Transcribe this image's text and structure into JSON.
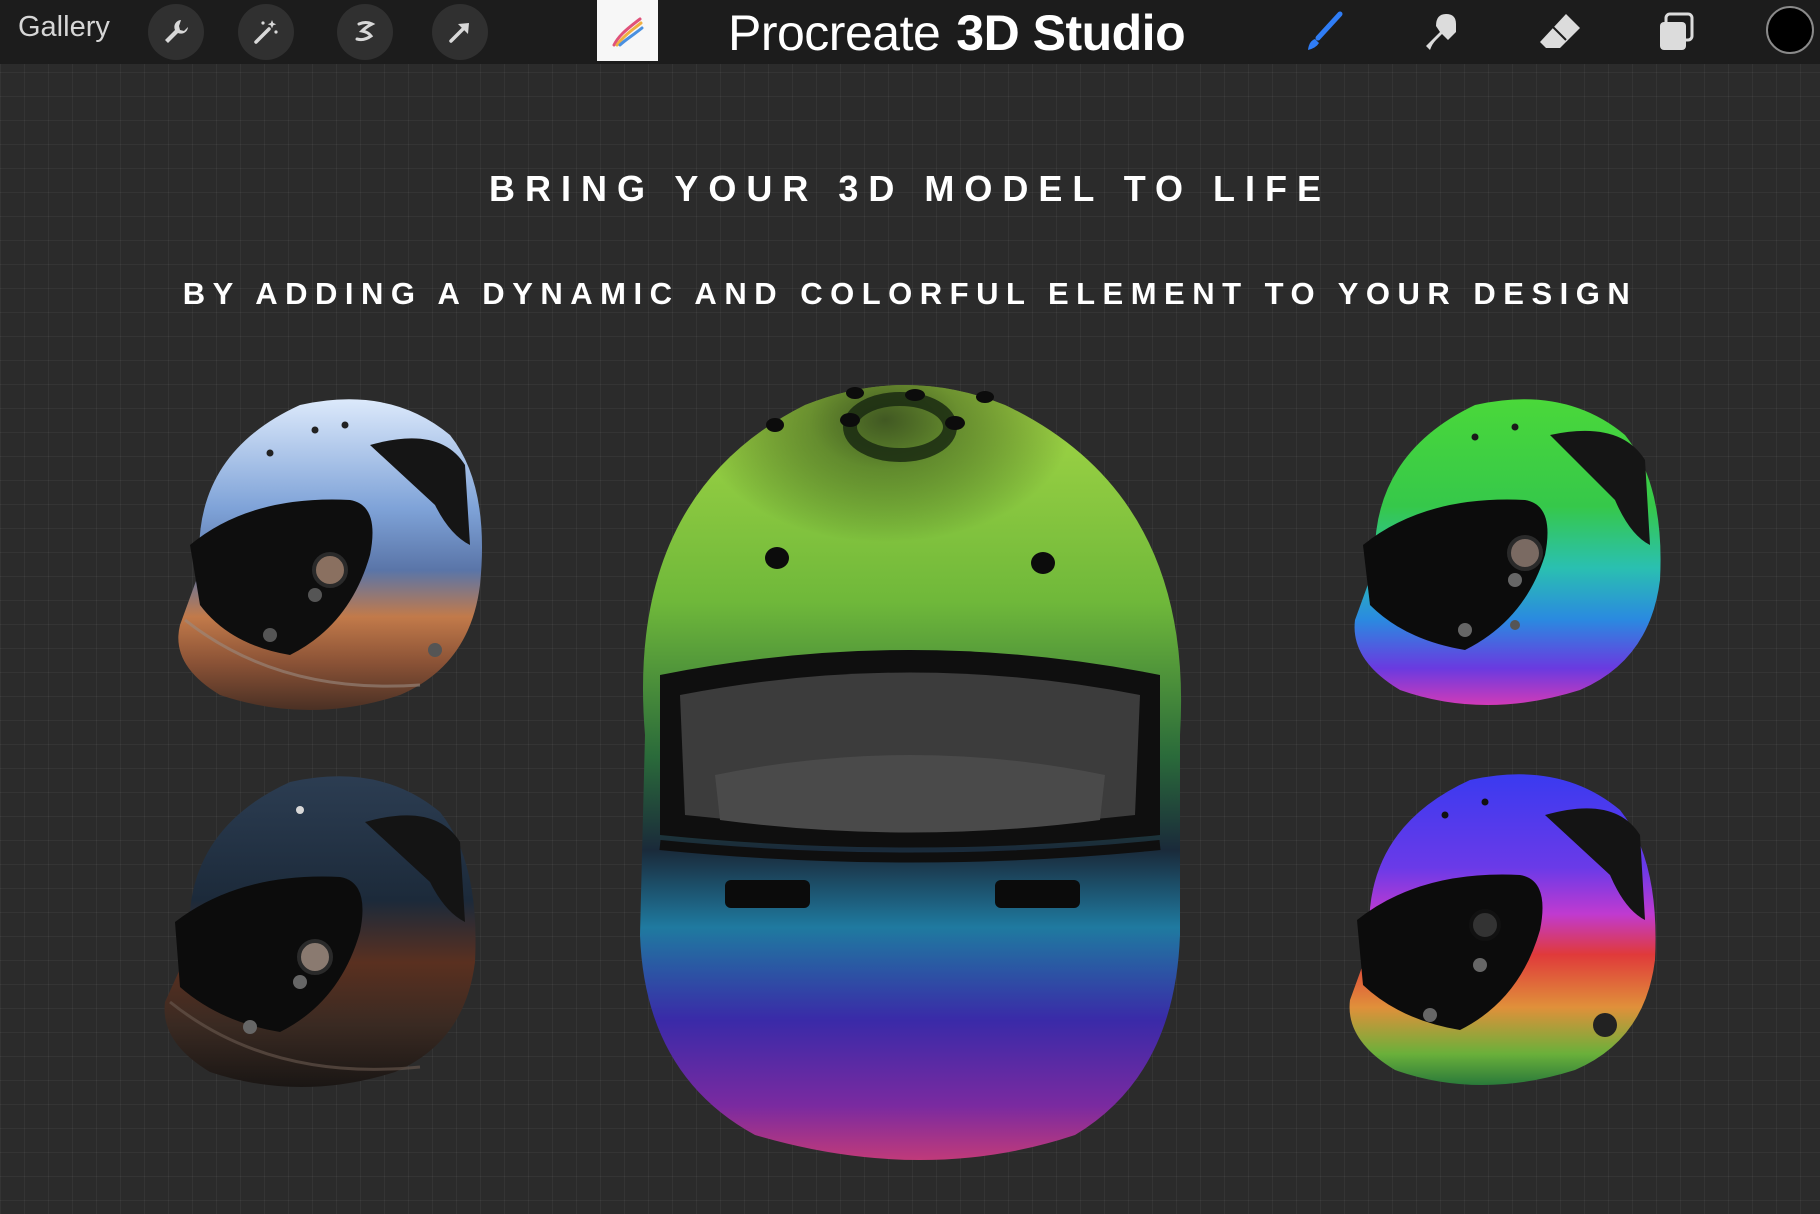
{
  "toolbar": {
    "gallery_label": "Gallery",
    "left_tools": [
      {
        "icon": "wrench-icon",
        "name": "actions"
      },
      {
        "icon": "magic-wand-icon",
        "name": "adjustments"
      },
      {
        "icon": "selection-icon",
        "name": "selection"
      },
      {
        "icon": "arrow-cursor-icon",
        "name": "transform"
      }
    ],
    "title_primary": "Procreate",
    "title_secondary": "3D Studio",
    "right_tools": [
      {
        "icon": "brush-icon",
        "name": "paint",
        "active": true,
        "color": "#2f7df6"
      },
      {
        "icon": "smudge-icon",
        "name": "smudge",
        "active": false,
        "color": "#dcdcdc"
      },
      {
        "icon": "eraser-icon",
        "name": "erase",
        "active": false,
        "color": "#dcdcdc"
      },
      {
        "icon": "layers-icon",
        "name": "layers",
        "active": false,
        "color": "#dcdcdc"
      }
    ],
    "current_color": "#000000"
  },
  "headings": {
    "line1": "BRING YOUR 3D MODEL TO LIFE",
    "line2": "BY ADDING A DYNAMIC AND COLORFUL ELEMENT TO YOUR DESIGN"
  },
  "colors": {
    "background": "#2b2b2b",
    "toolbar": "#1c1c1c",
    "accent": "#2f7df6"
  },
  "helmets": [
    {
      "id": "helmet-chrome-landscape",
      "finish": "chrome",
      "colors": [
        "#bcd4f2",
        "#6b8fc5",
        "#c86a3a",
        "#8a4a2a"
      ]
    },
    {
      "id": "helmet-dark-landscape",
      "finish": "dark chrome",
      "colors": [
        "#1c2a3a",
        "#243448",
        "#6a3520",
        "#3a2a20"
      ]
    },
    {
      "id": "helmet-tie-dye-main",
      "finish": "tie-dye",
      "colors": [
        "#9ad43a",
        "#5aa02a",
        "#26b0b8",
        "#4a2ad0",
        "#b02aa0"
      ]
    },
    {
      "id": "helmet-rainbow-gradient",
      "finish": "gradient",
      "colors": [
        "#3fd43a",
        "#28c8a0",
        "#2a9ae0",
        "#6a3ae0",
        "#d03ab8"
      ]
    },
    {
      "id": "helmet-rainbow-landscape",
      "finish": "iridescent chrome",
      "colors": [
        "#3a3af0",
        "#a03ae0",
        "#e03a3a",
        "#e0a03a",
        "#3ab03a"
      ]
    }
  ]
}
